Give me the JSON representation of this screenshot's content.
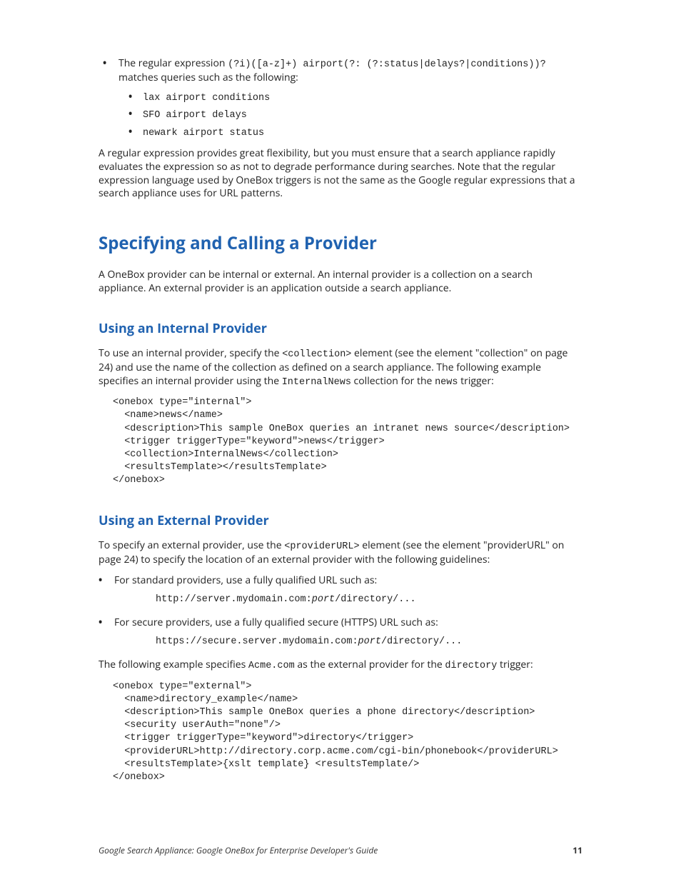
{
  "intro": {
    "bullet_lead": "The regular expression ",
    "regex": "(?i)([a-z]+) airport(?: (?:status|delays?|conditions))?",
    "bullet_tail": " matches queries such as the following:",
    "examples": [
      "lax airport conditions",
      "SFO airport delays",
      "newark airport status"
    ],
    "para": "A regular expression provides great flexibility, but you must ensure that a search appliance rapidly evaluates the expression so as not to degrade performance during searches. Note that the regular expression language used by OneBox triggers is not the same as the Google regular expressions that a search appliance uses for URL patterns."
  },
  "section1": {
    "heading": "Specifying and Calling a Provider",
    "para": "A OneBox provider can be internal or external. An internal provider is a collection on a search appliance. An external provider is an application outside a search appliance."
  },
  "internal": {
    "heading": "Using an Internal Provider",
    "para_a": "To use an internal provider, specify the ",
    "code_a": "<collection>",
    "para_b": " element (see the element \"collection\" on page 24) and use the name of the collection as defined on a search appliance. The following example specifies an internal provider using the ",
    "code_b": "InternalNews",
    "para_c": " collection for the ",
    "code_c": "news",
    "para_d": " trigger:",
    "code_block": "<onebox type=\"internal\">\n  <name>news</name>\n  <description>This sample OneBox queries an intranet news source</description>\n  <trigger triggerType=\"keyword\">news</trigger>\n  <collection>InternalNews</collection>\n  <resultsTemplate></resultsTemplate>\n</onebox>"
  },
  "external": {
    "heading": "Using an External Provider",
    "para_a": "To specify an external provider, use the ",
    "code_a": "<providerURL>",
    "para_b": " element (see the element \"providerURL\" on page 24) to specify the location of an external provider with the following guidelines:",
    "bullets": [
      {
        "text": "For standard providers, use a fully qualified URL such as:",
        "url_pre": "http://server.mydomain.com:",
        "url_ital": "port",
        "url_post": "/directory/..."
      },
      {
        "text": "For secure providers, use a fully qualified secure (HTTPS) URL such as:",
        "url_pre": "https://secure.server.mydomain.com:",
        "url_ital": "port",
        "url_post": "/directory/..."
      }
    ],
    "para_c_a": "The following example specifies ",
    "code_c": "Acme.com",
    "para_c_b": " as the external provider for the ",
    "code_d": "directory",
    "para_c_c": " trigger:",
    "code_block": "<onebox type=\"external\">\n  <name>directory_example</name>\n  <description>This sample OneBox queries a phone directory</description>\n  <security userAuth=\"none\"/>\n  <trigger triggerType=\"keyword\">directory</trigger>\n  <providerURL>http://directory.corp.acme.com/cgi-bin/phonebook</providerURL>\n  <resultsTemplate>{xslt template} <resultsTemplate/>\n</onebox>"
  },
  "footer": {
    "title": "Google Search Appliance: Google OneBox for Enterprise Developer's Guide",
    "page": "11"
  }
}
